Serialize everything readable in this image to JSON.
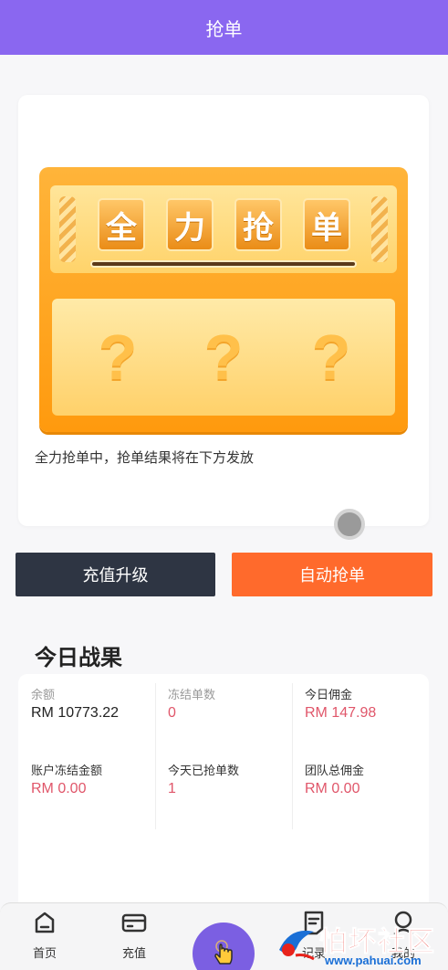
{
  "header": {
    "title": "抢单"
  },
  "machine": {
    "tiles": [
      "全",
      "力",
      "抢",
      "单"
    ],
    "qmarks": [
      "?",
      "?",
      "?"
    ]
  },
  "card": {
    "message": "全力抢单中，抢单结果将在下方发放"
  },
  "buttons": {
    "recharge": "充值升级",
    "auto": "自动抢单"
  },
  "colors": {
    "header": "#8a67f0",
    "accent": "#ff6a2c",
    "dark_button": "#2e3543",
    "value_red": "#e0566a"
  },
  "stats": {
    "title": "今日战果",
    "items": [
      {
        "label": "余额",
        "value": "RM 10773.22"
      },
      {
        "label": "冻结单数",
        "value": "0"
      },
      {
        "label": "今日佣金",
        "value": "RM 147.98"
      },
      {
        "label": "账户冻结金额",
        "value": "RM 0.00"
      },
      {
        "label": "今天已抢单数",
        "value": "1"
      },
      {
        "label": "团队总佣金",
        "value": "RM 0.00"
      }
    ]
  },
  "tabbar": {
    "items": [
      {
        "label": "首页",
        "icon": "home-icon"
      },
      {
        "label": "充值",
        "icon": "card-icon"
      },
      {
        "label": "",
        "icon": "tap-hand-icon"
      },
      {
        "label": "记录",
        "icon": "document-icon"
      },
      {
        "label": "我的",
        "icon": "user-icon"
      }
    ]
  },
  "watermark": {
    "title": "怕坏社区",
    "url": "www.pahuai.com"
  }
}
